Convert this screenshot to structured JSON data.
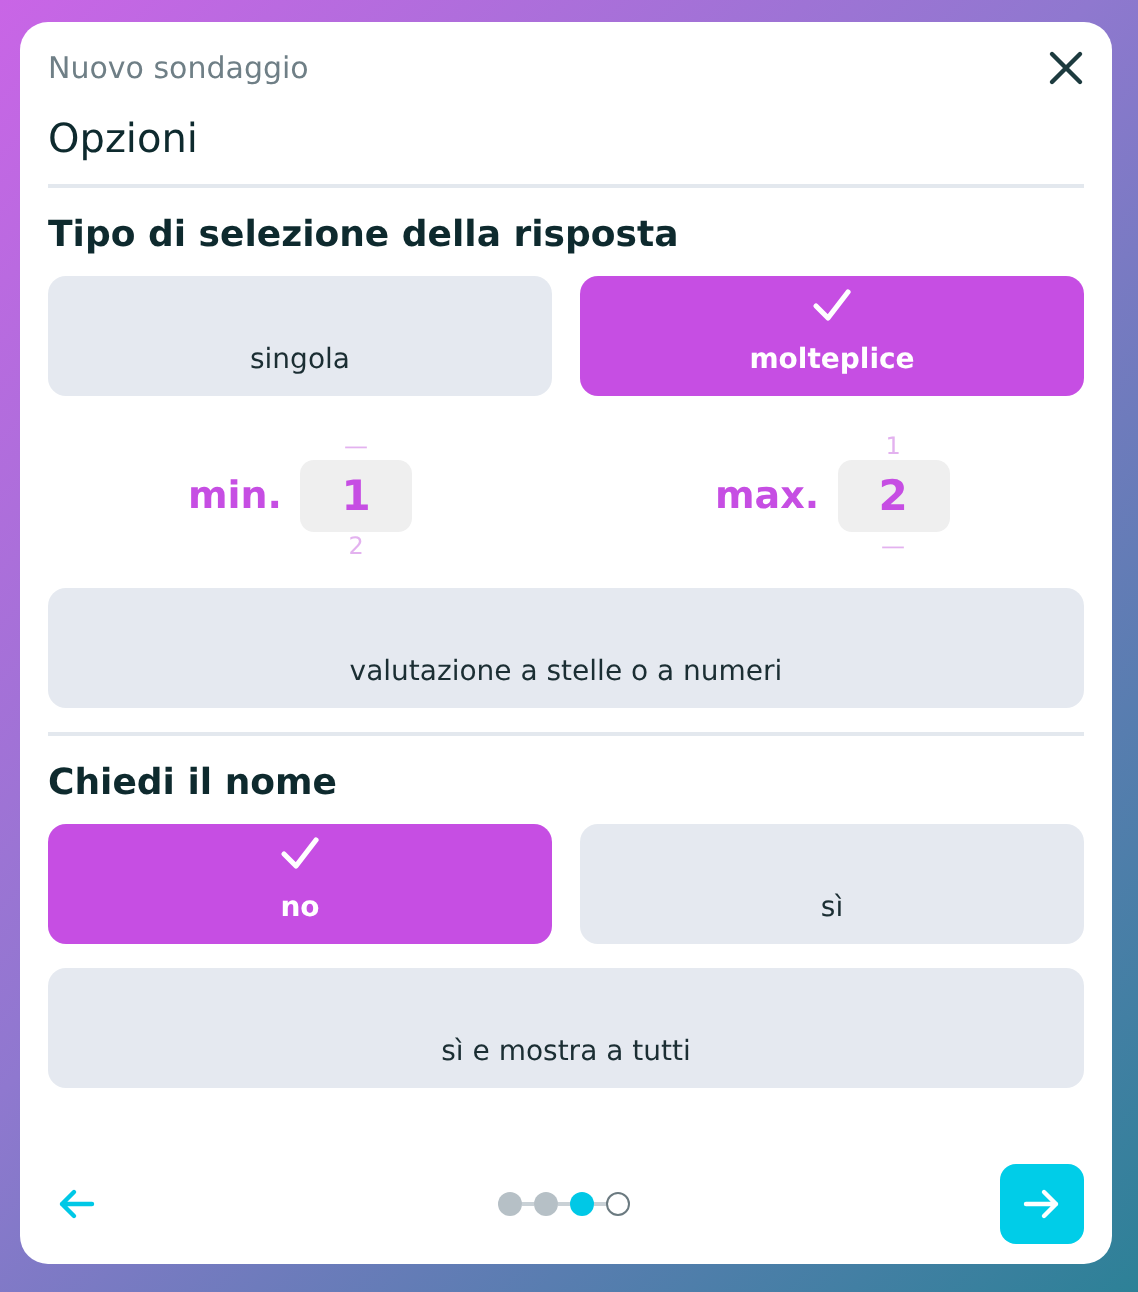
{
  "dialog": {
    "title": "Nuovo sondaggio",
    "heading": "Opzioni"
  },
  "sections": [
    {
      "title": "Tipo di selezione della risposta",
      "options": [
        {
          "label": "singola",
          "selected": false
        },
        {
          "label": "molteplice",
          "selected": true
        }
      ],
      "spinners": [
        {
          "label": "min.",
          "previous": "—",
          "value": "1",
          "next": "2"
        },
        {
          "label": "max.",
          "previous": "1",
          "value": "2",
          "next": "—"
        }
      ],
      "extra_options": [
        {
          "label": "valutazione a stelle o a numeri",
          "selected": false
        }
      ]
    },
    {
      "title": "Chiedi il nome",
      "options": [
        {
          "label": "no",
          "selected": true
        },
        {
          "label": "sì",
          "selected": false
        }
      ],
      "extra_options": [
        {
          "label": "sì e mostra a tutti",
          "selected": false
        }
      ]
    }
  ],
  "steps": [
    {
      "kind": "done"
    },
    {
      "kind": "done"
    },
    {
      "kind": "current"
    },
    {
      "kind": "todo"
    }
  ]
}
